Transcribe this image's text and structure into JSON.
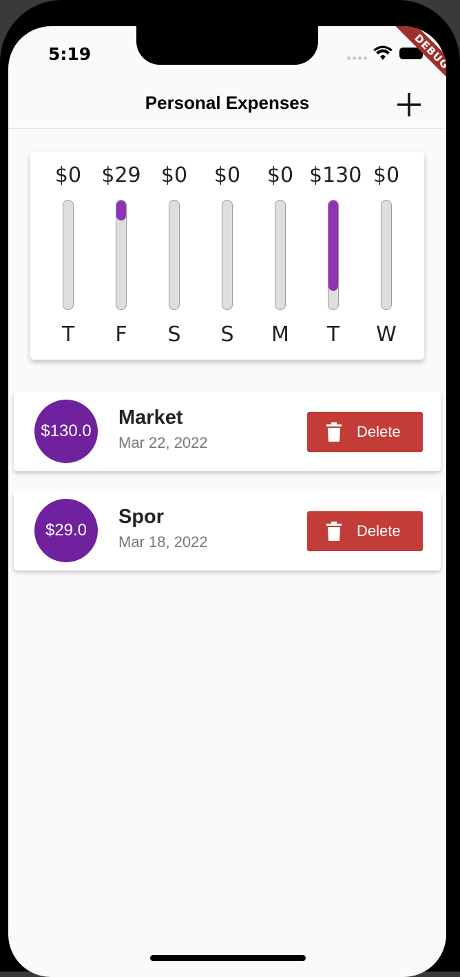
{
  "status_bar": {
    "time": "5:19",
    "debug_label": "DEBUG"
  },
  "appbar": {
    "title": "Personal Expenses",
    "add_icon": "plus-icon"
  },
  "chart_data": {
    "type": "bar",
    "categories": [
      "T",
      "F",
      "S",
      "S",
      "M",
      "T",
      "W"
    ],
    "value_labels": [
      "$0",
      "$29",
      "$0",
      "$0",
      "$0",
      "$130",
      "$0"
    ],
    "values": [
      0,
      29,
      0,
      0,
      0,
      130,
      0
    ],
    "ylim": [
      0,
      159
    ],
    "colors": {
      "fill": "#8e34b4",
      "track": "#dedede"
    }
  },
  "transactions": [
    {
      "amount": "$130.0",
      "title": "Market",
      "date": "Mar 22, 2022",
      "delete_label": "Delete"
    },
    {
      "amount": "$29.0",
      "title": "Spor",
      "date": "Mar 18, 2022",
      "delete_label": "Delete"
    }
  ],
  "colors": {
    "primary": "#6f219e",
    "danger": "#c43c37"
  }
}
